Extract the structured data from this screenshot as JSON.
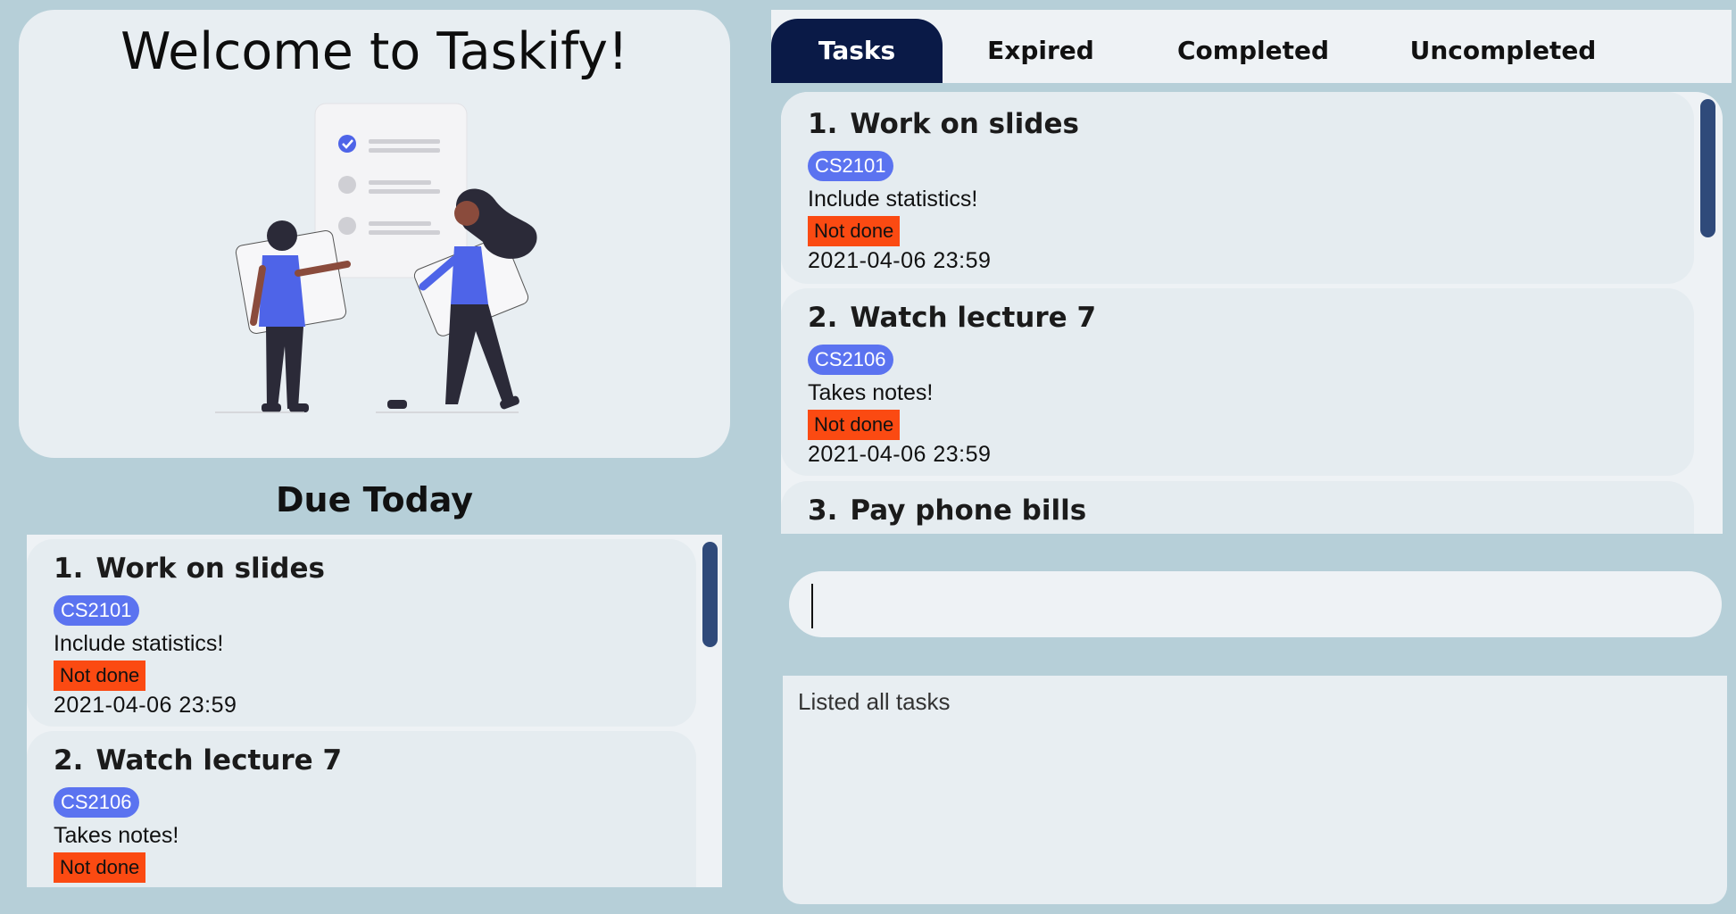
{
  "welcome": {
    "title": "Welcome to Taskify!"
  },
  "due_today": {
    "heading": "Due Today",
    "tasks": [
      {
        "index": "1.",
        "name": "Work on slides",
        "tag": "CS2101",
        "description": "Include statistics!",
        "status": "Not done",
        "deadline": "2021-04-06 23:59"
      },
      {
        "index": "2.",
        "name": "Watch lecture 7",
        "tag": "CS2106",
        "description": "Takes notes!",
        "status": "Not done"
      }
    ]
  },
  "tabs": [
    {
      "label": "Tasks",
      "active": true
    },
    {
      "label": "Expired"
    },
    {
      "label": "Completed"
    },
    {
      "label": "Uncompleted"
    }
  ],
  "task_list": {
    "tasks": [
      {
        "index": "1.",
        "name": "Work on slides",
        "tag": "CS2101",
        "description": "Include statistics!",
        "status": "Not done",
        "deadline": "2021-04-06 23:59"
      },
      {
        "index": "2.",
        "name": "Watch lecture 7",
        "tag": "CS2106",
        "description": "Takes notes!",
        "status": "Not done",
        "deadline": "2021-04-06 23:59"
      },
      {
        "index": "3.",
        "name": "Pay phone bills"
      }
    ]
  },
  "command_box": {
    "value": ""
  },
  "result_display": {
    "text": "Listed all tasks"
  },
  "colors": {
    "background": "#b6cfd8",
    "active_tab": "#0a1a47",
    "tag": "#5b73f0",
    "status_not_done": "#fb4a12",
    "scrollbar": "#2f4a7a"
  }
}
